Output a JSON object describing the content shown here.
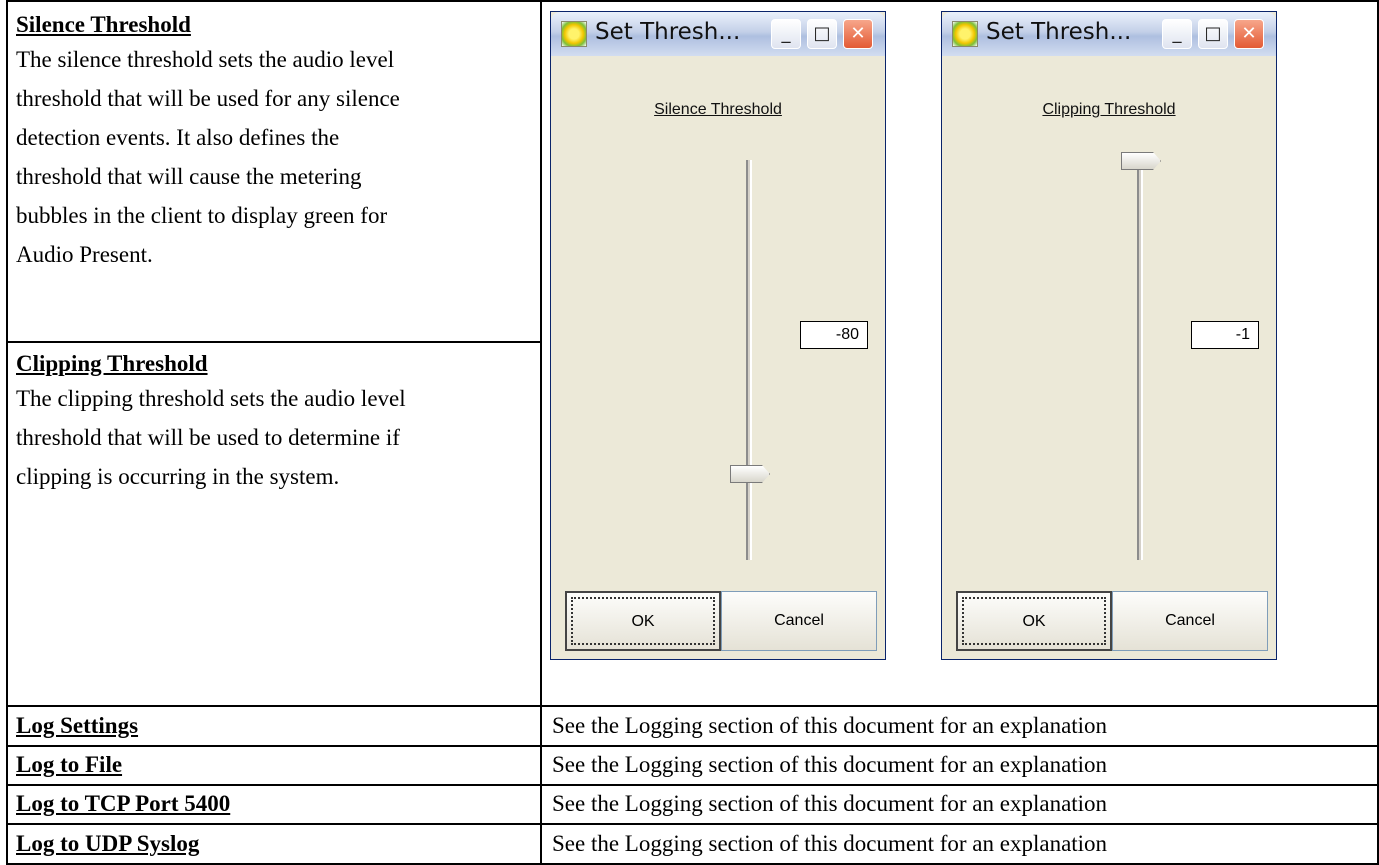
{
  "silence": {
    "heading": "Silence Threshold",
    "lines": [
      "The silence threshold sets the audio level",
      "threshold that will be used for any silence",
      "detection events.  It also defines the",
      "threshold that will cause the metering",
      "bubbles in the client to display green for",
      "Audio Present."
    ]
  },
  "clipping": {
    "heading": "Clipping Threshold",
    "lines": [
      "The clipping threshold sets the audio level",
      "threshold that will be used to determine if",
      "clipping is occurring in the system."
    ]
  },
  "dialogs": [
    {
      "title": "Set Thresh...",
      "label": "Silence Threshold",
      "value": "-80",
      "ok_label": "OK",
      "cancel_label": "Cancel",
      "minimize_icon": "minimize-icon",
      "maximize_icon": "maximize-icon",
      "close_icon": "close-icon"
    },
    {
      "title": "Set Thresh...",
      "label": "Clipping Threshold",
      "value": "-1",
      "ok_label": "OK",
      "cancel_label": "Cancel",
      "minimize_icon": "minimize-icon",
      "maximize_icon": "maximize-icon",
      "close_icon": "close-icon"
    }
  ],
  "rows": [
    {
      "label": "Log Settings",
      "desc": "See the Logging section of this document for an explanation"
    },
    {
      "label": "Log to File",
      "desc": "See the Logging section of this document for an explanation"
    },
    {
      "label": "Log to TCP Port 5400",
      "desc": "See the Logging section of this document for an explanation"
    },
    {
      "label": "Log to UDP Syslog",
      "desc": "See the Logging section of this document for an explanation"
    }
  ]
}
